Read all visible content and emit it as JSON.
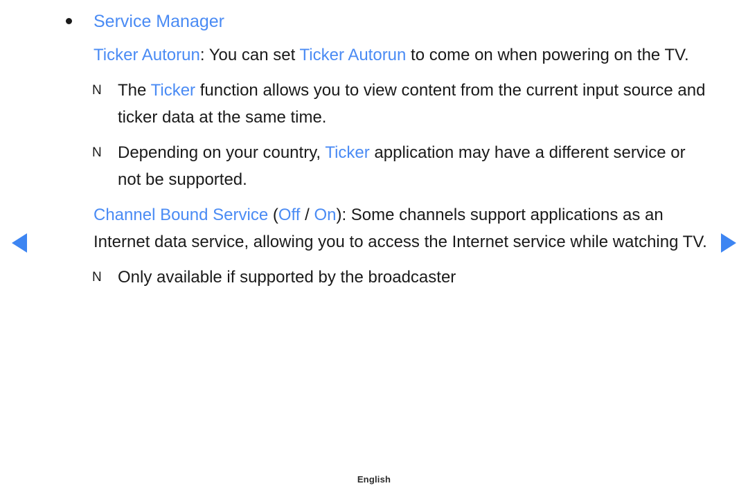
{
  "page": {
    "background_color": "#ffffff",
    "accent_color": "#4a8bf4",
    "text_color": "#1a1a1a"
  },
  "nav": {
    "prev_label": "◀",
    "next_label": "▶"
  },
  "content": {
    "bullet": {
      "title": "Service Manager"
    },
    "paragraphs": [
      {
        "type": "body",
        "segments": [
          {
            "text": "Ticker Autorun",
            "color": "accent"
          },
          {
            "text": ": You can set ",
            "color": "text"
          },
          {
            "text": "Ticker Autorun",
            "color": "accent"
          },
          {
            "text": " to come on when powering on the TV.",
            "color": "text"
          }
        ]
      },
      {
        "type": "note",
        "marker": "N",
        "segments": [
          {
            "text": "The ",
            "color": "text"
          },
          {
            "text": "Ticker",
            "color": "accent"
          },
          {
            "text": " function allows you to view content from the current input source and ticker data at the same time.",
            "color": "text"
          }
        ]
      },
      {
        "type": "note",
        "marker": "N",
        "segments": [
          {
            "text": "Depending on your country, ",
            "color": "text"
          },
          {
            "text": "Ticker",
            "color": "accent"
          },
          {
            "text": " application may have a different service or not be supported.",
            "color": "text"
          }
        ]
      },
      {
        "type": "body",
        "segments": [
          {
            "text": "Channel Bound Service",
            "color": "accent"
          },
          {
            "text": " (",
            "color": "text"
          },
          {
            "text": "Off",
            "color": "accent"
          },
          {
            "text": " / ",
            "color": "text"
          },
          {
            "text": "On",
            "color": "accent"
          },
          {
            "text": "): Some channels support applications as an Internet data service, allowing you to access the Internet service while watching TV.",
            "color": "text"
          }
        ]
      },
      {
        "type": "note",
        "marker": "N",
        "segments": [
          {
            "text": "Only available if supported by the broadcaster",
            "color": "text"
          }
        ]
      }
    ]
  },
  "footer": {
    "language": "English"
  }
}
